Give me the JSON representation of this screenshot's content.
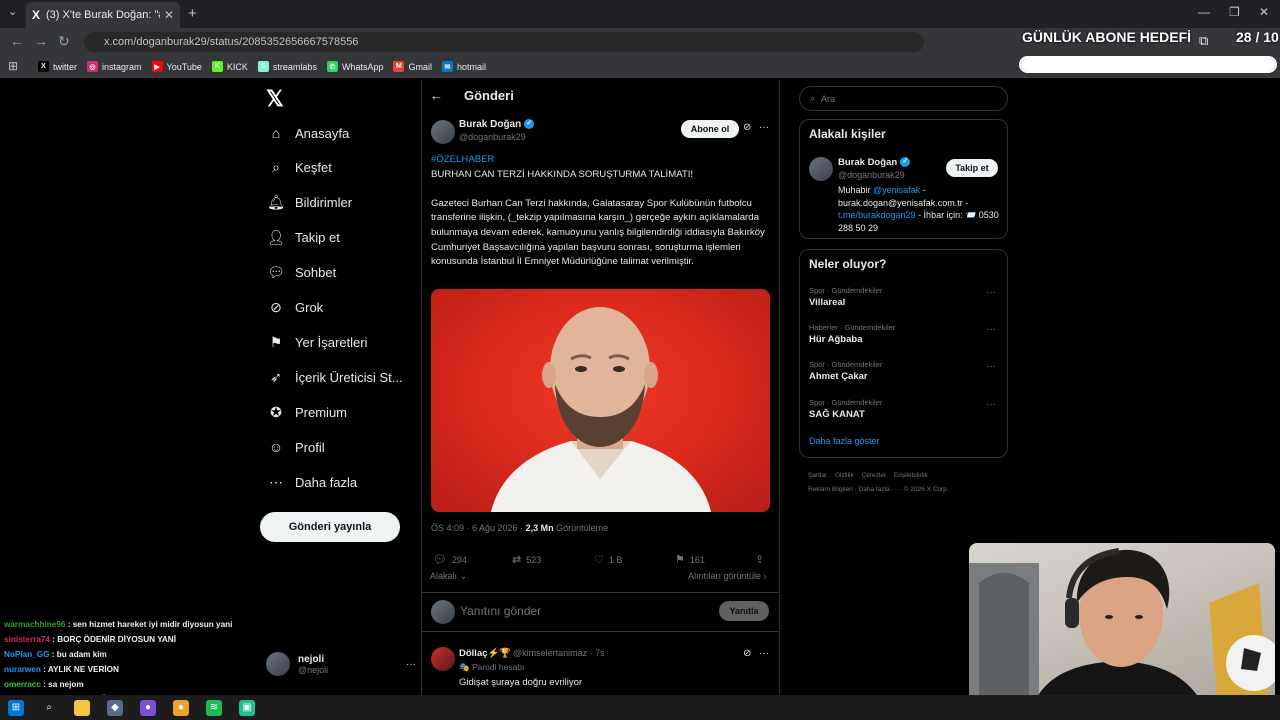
{
  "browser": {
    "tab_title": "(3) X'te Burak Doğan: \"#ÖZELH",
    "tab_close": "✕",
    "new_tab": "+",
    "url": "x.com/doganburak29/status/2085352656667578556",
    "bookmarks": [
      {
        "label": "twitter",
        "icon": "x-icon",
        "color": "#000000",
        "glyph": "X"
      },
      {
        "label": "instagram",
        "icon": "instagram-icon",
        "color": "#d62976",
        "glyph": "◎"
      },
      {
        "label": "YouTube",
        "icon": "youtube-icon",
        "color": "#ff0000",
        "glyph": "▶"
      },
      {
        "label": "KICK",
        "icon": "kick-icon",
        "color": "#53fc18",
        "glyph": "K"
      },
      {
        "label": "streamlabs",
        "icon": "streamlabs-icon",
        "color": "#80f5d2",
        "glyph": "S"
      },
      {
        "label": "WhatsApp",
        "icon": "whatsapp-icon",
        "color": "#25d366",
        "glyph": "✆"
      },
      {
        "label": "Gmail",
        "icon": "gmail-icon",
        "color": "#ea4335",
        "glyph": "M"
      },
      {
        "label": "hotmail",
        "icon": "hotmail-icon",
        "color": "#0078d4",
        "glyph": "✉"
      }
    ]
  },
  "overlay": {
    "goal_label": "GÜNLÜK ABONE HEDEFİ",
    "goal_count": "28 / 10",
    "goal_progress": 1.0
  },
  "nav": {
    "items": [
      {
        "label": "Anasayfa",
        "icon": "home-icon"
      },
      {
        "label": "Keşfet",
        "icon": "search-icon"
      },
      {
        "label": "Bildirimler",
        "icon": "bell-icon"
      },
      {
        "label": "Takip et",
        "icon": "follow-icon"
      },
      {
        "label": "Sohbet",
        "icon": "chat-icon"
      },
      {
        "label": "Grok",
        "icon": "grok-icon"
      },
      {
        "label": "Yer İşaretleri",
        "icon": "bookmark-icon"
      },
      {
        "label": "İçerik Üreticisi St...",
        "icon": "rocket-icon"
      },
      {
        "label": "Premium",
        "icon": "premium-icon"
      },
      {
        "label": "Profil",
        "icon": "profile-icon"
      },
      {
        "label": "Daha fazla",
        "icon": "more-circle-icon"
      }
    ],
    "post_button": "Gönderi yayınla",
    "account_name": "nejoli",
    "account_handle": "@nejoli",
    "account_more": "···"
  },
  "post": {
    "header": "Gönderi",
    "author_name": "Burak Doğan",
    "author_handle": "@doganburak29",
    "subscribe_label": "Abone ol",
    "hashtag": "#ÖZELHABER",
    "headline": "BURHAN CAN TERZİ HAKKINDA SORUŞTURMA TALİMATI!",
    "body": "Gazeteci Burhan Can Terzi hakkında, Galatasaray Spor Kulübünün futbolcu transferine ilişkin, (_tekzip yapılmasına karşın_) gerçeğe aykırı açıklamalarda bulunmaya devam ederek, kamuoyunu yanlış bilgilendirdiği iddiasıyla Bakırköy Cumhuriyet Başsavcılığına yapılan başvuru sonrası, soruşturma işlemleri konusunda İstanbul İl Emniyet Müdürlüğüne talimat verilmiştir.",
    "time": "ÖS 4:09 · 6 Ağu 2026 · ",
    "views_count": "2,3 Mn",
    "views_label": " Görüntüleme",
    "replies": "294",
    "reposts": "523",
    "likes": "1 B",
    "bookmarks": "161",
    "related": "Alakalı",
    "quotes": "Alıntıları görüntüle",
    "reply_placeholder": "Yanıtını gönder",
    "reply_button": "Yanıtla"
  },
  "reply": {
    "author": "Döllaç⚡🏆",
    "handle": "@kimselertanimaz · 7s",
    "parody": "🎭 Parodi hesabı",
    "text": "Gidişat şuraya doğru evriliyor"
  },
  "sidebar": {
    "search_placeholder": "Ara",
    "related_title": "Alakalı kişiler",
    "related_name": "Burak Doğan",
    "related_handle": "@doganburak29",
    "follow_label": "Takip et",
    "bio_prefix": "Muhabir ",
    "bio_link1": "@yenisafak",
    "bio_mid": " - burak.dogan@yenisafak.com.tr - ",
    "bio_link2": "t.me/burakdogan29",
    "bio_suffix": " - İhbar için: 📨 0530 288 50 29",
    "trends_title": "Neler oluyor?",
    "trends": [
      {
        "category": "Spor · Gündemdekiler",
        "name": "Villareal"
      },
      {
        "category": "Haberler · Gündemdekiler",
        "name": "Hür Ağbaba"
      },
      {
        "category": "Spor · Gündemdekiler",
        "name": "Ahmet Çakar"
      },
      {
        "category": "Spor · Gündemdekiler",
        "name": "SAĞ KANAT"
      }
    ],
    "show_more": "Daha fazla göster",
    "footer_line1": "Şartlar Gizlilik Çerezler Erişilebilirlik",
    "footer_line2": "Reklam Bilgileri · Daha fazla ··· · © 2026 X Corp."
  },
  "chat": [
    {
      "user": "warmachhine96",
      "color": "#2e9e2e",
      "text": " : sen hizmet hareket iyi midir diyosun yani"
    },
    {
      "user": "sinisterra74",
      "color": "#e0245e",
      "text": " : BORÇ ÖDENİR DİYOSUN YANİ"
    },
    {
      "user": "NoPlan_GG",
      "color": "#1d9bf0",
      "text": " : bu adam kim"
    },
    {
      "user": "nurarwen",
      "color": "#1d9bf0",
      "text": " : AYLIK NE VERİON"
    },
    {
      "user": "omerracc",
      "color": "#2ecc40",
      "text": " : sa nejom"
    },
    {
      "user": "yumyumut",
      "color": "#e0245e",
      "text": " : BORÇ BATAĞINA GİRİCEZ GİBİ BİZDE"
    }
  ],
  "taskbar": [
    {
      "icon": "windows-start-icon",
      "color": "#0078d4",
      "glyph": "⊞"
    },
    {
      "icon": "search-icon",
      "color": "#1c1c1c",
      "glyph": "⌕"
    },
    {
      "icon": "folder-icon",
      "color": "#f4c542",
      "glyph": ""
    },
    {
      "icon": "app-icon",
      "color": "#5a6b86",
      "glyph": "◆"
    },
    {
      "icon": "obs-icon",
      "color": "#7b4fd6",
      "glyph": "●"
    },
    {
      "icon": "chrome-icon",
      "color": "#e8a32b",
      "glyph": "●"
    },
    {
      "icon": "spotify-icon",
      "color": "#1db954",
      "glyph": "≋"
    },
    {
      "icon": "streamlabs-icon",
      "color": "#1fbf8f",
      "glyph": "▣"
    }
  ]
}
